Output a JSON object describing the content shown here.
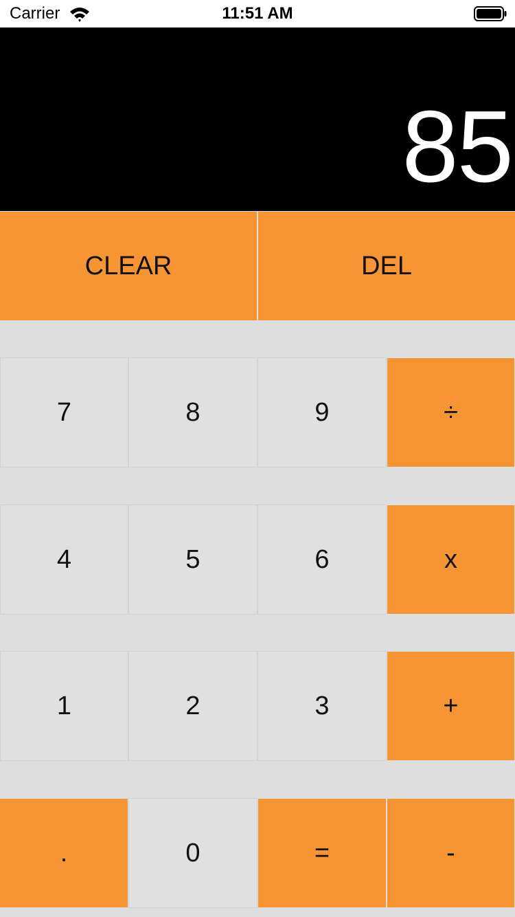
{
  "status_bar": {
    "carrier": "Carrier",
    "time": "11:51 AM"
  },
  "display": {
    "value": "85"
  },
  "keys": {
    "clear": "CLEAR",
    "del": "DEL",
    "seven": "7",
    "eight": "8",
    "nine": "9",
    "divide": "÷",
    "four": "4",
    "five": "5",
    "six": "6",
    "multiply": "x",
    "one": "1",
    "two": "2",
    "three": "3",
    "plus": "+",
    "decimal": ".",
    "zero": "0",
    "equals": "=",
    "minus": "-"
  },
  "colors": {
    "accent": "#f79433",
    "key_gray": "#e0e0e0",
    "display_bg": "#000000",
    "display_text": "#ffffff"
  }
}
